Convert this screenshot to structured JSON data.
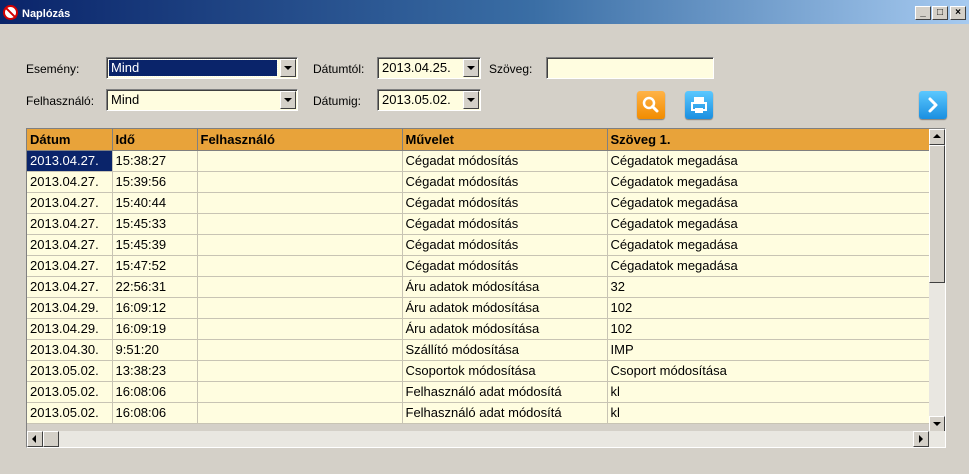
{
  "window": {
    "title": "Naplózás",
    "buttons": {
      "minimize": "_",
      "maximize": "□",
      "close": "×"
    }
  },
  "filters": {
    "event_label": "Esemény:",
    "event_value": "Mind",
    "user_label": "Felhasználó:",
    "user_value": "Mind",
    "date_from_label": "Dátumtól:",
    "date_from_value": "2013.04.25.",
    "date_to_label": "Dátumig:",
    "date_to_value": "2013.05.02.",
    "text_label": "Szöveg:",
    "text_value": ""
  },
  "icons": {
    "search": "search-icon",
    "print": "print-icon",
    "next": "chevron-right-icon"
  },
  "colors": {
    "header_bg": "#e8a33a",
    "row_bg": "#fffde0",
    "selection": "#0a246a",
    "search_button": "#f28c00",
    "print_button": "#1a8fe0"
  },
  "table": {
    "columns": [
      "Dátum",
      "Idő",
      "Felhasználó",
      "Művelet",
      "Szöveg 1."
    ],
    "rows": [
      [
        "2013.04.27.",
        "15:38:27",
        "",
        "Cégadat módosítás",
        "Cégadatok megadása"
      ],
      [
        "2013.04.27.",
        "15:39:56",
        "",
        "Cégadat módosítás",
        "Cégadatok megadása"
      ],
      [
        "2013.04.27.",
        "15:40:44",
        "",
        "Cégadat módosítás",
        "Cégadatok megadása"
      ],
      [
        "2013.04.27.",
        "15:45:33",
        "",
        "Cégadat módosítás",
        "Cégadatok megadása"
      ],
      [
        "2013.04.27.",
        "15:45:39",
        "",
        "Cégadat módosítás",
        "Cégadatok megadása"
      ],
      [
        "2013.04.27.",
        "15:47:52",
        "",
        "Cégadat módosítás",
        "Cégadatok megadása"
      ],
      [
        "2013.04.27.",
        "22:56:31",
        "",
        "Áru adatok módosítása",
        "32"
      ],
      [
        "2013.04.29.",
        "16:09:12",
        "",
        "Áru adatok módosítása",
        "102"
      ],
      [
        "2013.04.29.",
        "16:09:19",
        "",
        "Áru adatok módosítása",
        "102"
      ],
      [
        "2013.04.30.",
        "9:51:20",
        "",
        "Szállító módosítása",
        "IMP"
      ],
      [
        "2013.05.02.",
        "13:38:23",
        "",
        "Csoportok módosítása",
        "Csoport módosítása"
      ],
      [
        "2013.05.02.",
        "16:08:06",
        "",
        "Felhasználó adat módosítá",
        "kl"
      ],
      [
        "2013.05.02.",
        "16:08:06",
        "",
        "Felhasználó adat módosítá",
        "kl"
      ]
    ]
  }
}
